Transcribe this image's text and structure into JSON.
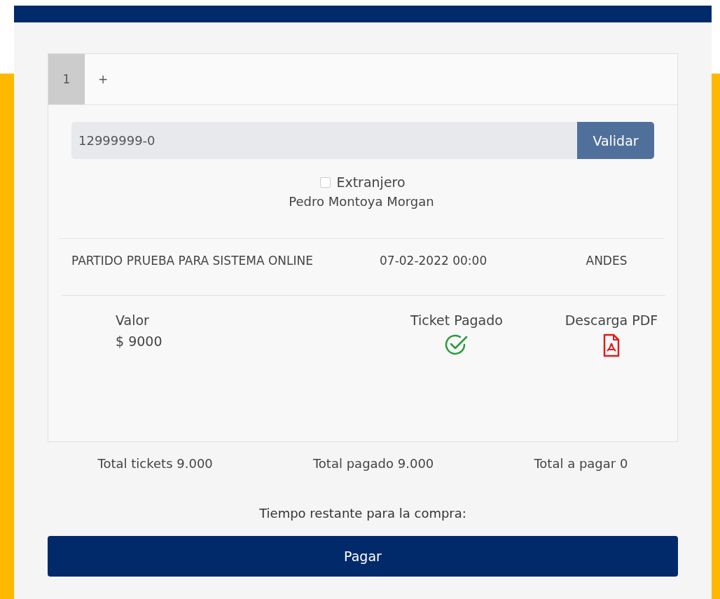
{
  "tabs": [
    {
      "label": "1",
      "selected": true
    },
    {
      "label": "+",
      "selected": false
    }
  ],
  "id_field": {
    "value": "12999999-0",
    "button": "Validar"
  },
  "foreigner": {
    "label": "Extranjero",
    "checked": false
  },
  "holder_name": "Pedro Montoya Morgan",
  "event": {
    "name": "PARTIDO PRUEBA PARA SISTEMA ONLINE",
    "date": "07-02-2022 00:00",
    "venue": "ANDES"
  },
  "ticket": {
    "value_label": "Valor",
    "value": "$ 9000",
    "status_label": "Ticket Pagado",
    "paid": true,
    "download_label": "Descarga PDF"
  },
  "totals": [
    "Total tickets 9.000",
    "Total pagado 9.000",
    "Total a pagar 0"
  ],
  "timer_label": "Tiempo restante para la compra:",
  "pay_button": "Pagar"
}
